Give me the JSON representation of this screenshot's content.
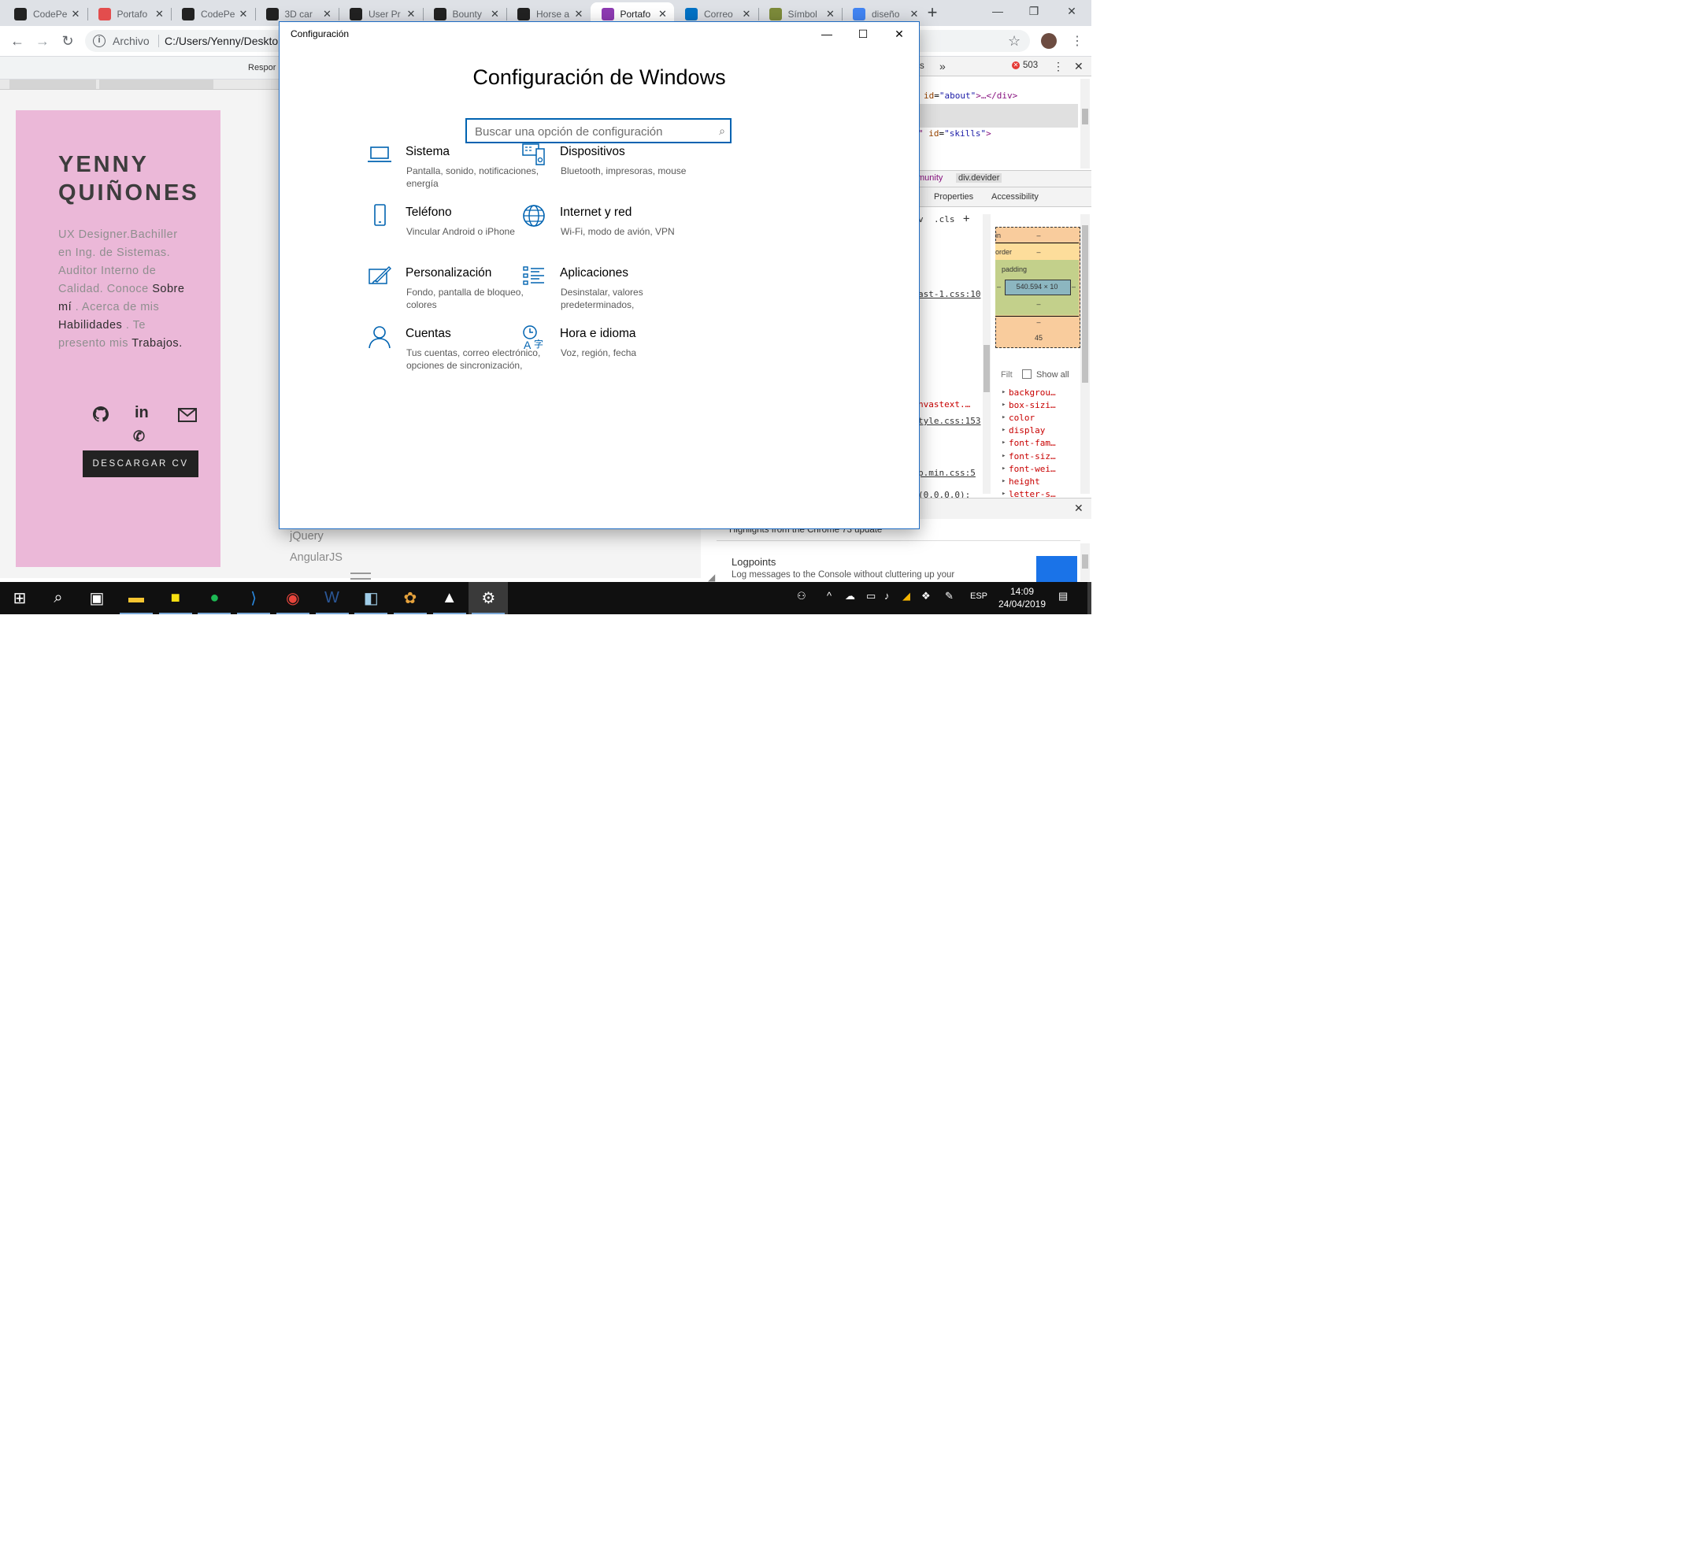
{
  "browser": {
    "tabs": [
      {
        "title": "CodePe",
        "favicon": "codepen-icon",
        "color": "#222222"
      },
      {
        "title": "Portafo",
        "favicon": "adobe-portfolio-icon",
        "color": "#e34d4d"
      },
      {
        "title": "CodePe",
        "favicon": "codepen-icon",
        "color": "#222222"
      },
      {
        "title": "3D car",
        "favicon": "codepen-icon",
        "color": "#222222"
      },
      {
        "title": "User Pr",
        "favicon": "codepen-icon",
        "color": "#222222"
      },
      {
        "title": "Bounty",
        "favicon": "codepen-icon",
        "color": "#222222"
      },
      {
        "title": "Horse a",
        "favicon": "codepen-icon",
        "color": "#222222"
      },
      {
        "title": "Portafo",
        "favicon": "portfolio-icon",
        "color": "#8e3bb3"
      },
      {
        "title": "Correo",
        "favicon": "outlook-icon",
        "color": "#0072c6"
      },
      {
        "title": "Símbol",
        "favicon": "site-icon",
        "color": "#7d8b3a"
      },
      {
        "title": "diseño",
        "favicon": "google-icon",
        "color": "#4285f4"
      }
    ],
    "close_symbol": "✕",
    "new_tab_symbol": "+",
    "address": {
      "protocol": "Archivo",
      "url": "C:/Users/Yenny/Deskto"
    }
  },
  "page": {
    "device_toolbar_label": "Respor",
    "name_line1": "YENNY",
    "name_line2": "QUIÑONES",
    "bio": {
      "p1": "UX Designer.Bachiller en Ing. de Sistemas. Auditor Interno de Calidad. Conoce",
      "link1": "Sobre mí",
      "p2": ". Acerca de mis",
      "link2": "Habilidades",
      "p3": ". Te presento mis",
      "link3": "Trabajos",
      "p4": "."
    },
    "social_icons": [
      "github-icon",
      "linkedin-icon",
      "mail-icon",
      "phone-icon"
    ],
    "cv_button": "DESCARGAR CV",
    "skills": [
      "jQuery",
      "AngularJS"
    ]
  },
  "devtools": {
    "error_count": "503",
    "html_lines": [
      {
        "attr": "id",
        "value": "\"about\"",
        "rest": ">…</div>"
      },
      {
        "attr": "id",
        "value": "\"skills\"",
        "rest": ">"
      }
    ],
    "breadcrumbs": [
      "munity",
      "div.devider"
    ],
    "tabs": [
      "Properties",
      "Accessibility"
    ],
    "styles_toolbar": [
      "v",
      ".cls",
      "+"
    ],
    "sources": [
      "ast-1.css:10",
      "nvastext.…",
      "tyle.css:153",
      "p.min.css:5",
      "(0,0,0,0);"
    ],
    "box_model": {
      "margin_label": "in",
      "border_label": "order",
      "padding_label": "padding",
      "content": "540.594 × 10",
      "dash": "–",
      "bottom_value": "45"
    },
    "filter_placeholder": "Filt",
    "show_all": "Show all",
    "computed_props": [
      "backgrou…",
      "box-sizi…",
      "color",
      "display",
      "font-fam…",
      "font-siz…",
      "font-wei…",
      "height",
      "letter-s…"
    ],
    "whats_new_title": "Highlights from the Chrome 73 update",
    "whats_new_item": "Logpoints",
    "whats_new_desc": "Log messages to the Console without cluttering up your"
  },
  "settings": {
    "window_title": "Configuración",
    "heading": "Configuración de Windows",
    "search_placeholder": "Buscar una opción de configuración",
    "categories": [
      {
        "name": "Sistema",
        "desc": "Pantalla, sonido, notificaciones, energía",
        "icon": "laptop-icon"
      },
      {
        "name": "Dispositivos",
        "desc": "Bluetooth, impresoras, mouse",
        "icon": "devices-icon"
      },
      {
        "name": "Teléfono",
        "desc": "Vincular Android o iPhone",
        "icon": "phone-icon"
      },
      {
        "name": "Internet y red",
        "desc": "Wi-Fi, modo de avión, VPN",
        "icon": "globe-icon"
      },
      {
        "name": "Personalización",
        "desc": "Fondo, pantalla de bloqueo, colores",
        "icon": "paint-icon"
      },
      {
        "name": "Aplicaciones",
        "desc": "Desinstalar, valores predeterminados,",
        "icon": "apps-list-icon"
      },
      {
        "name": "Cuentas",
        "desc": "Tus cuentas, correo electrónico, opciones de sincronización,",
        "icon": "person-icon"
      },
      {
        "name": "Hora e idioma",
        "desc": "Voz, región, fecha",
        "icon": "time-language-icon"
      }
    ],
    "accent": "#0063b1"
  },
  "taskbar": {
    "apps": [
      "start-icon",
      "search-icon",
      "task-view-icon",
      "file-explorer-icon",
      "sticky-notes-icon",
      "spotify-icon",
      "vscode-icon",
      "chrome-icon",
      "word-icon",
      "app-icon",
      "paint-icon",
      "photos-icon",
      "settings-gear-icon"
    ],
    "language": "ESP",
    "time": "14:09",
    "date": "24/04/2019"
  }
}
